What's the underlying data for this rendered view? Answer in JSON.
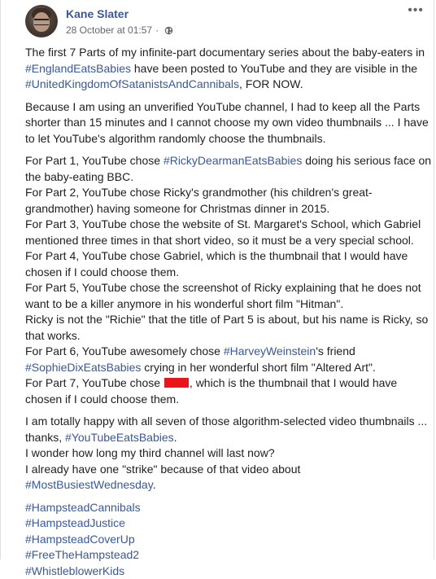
{
  "post": {
    "author": "Kane Slater",
    "timestamp": "28 October at 01:57",
    "separator": "·",
    "privacy_icon": "globe-icon",
    "more_label": "•••",
    "p1": {
      "a": "The first 7 Parts of my infinite-part documentary series about the baby-eaters in",
      "tag1": "#EnglandEatsBabies",
      "b": " have been posted to YouTube and they are visible in the",
      "tag2": "#UnitedKingdomOfSatanistsAndCannibals",
      "c": ", FOR NOW."
    },
    "p2": "Because I am using an unverified YouTube channel, I had to keep all the Parts shorter than 15 minutes and I cannot choose my own video thumbnails ... I have to let YouTube's algorithm randomly choose the thumbnails.",
    "p3": {
      "l1a": "For Part 1, YouTube chose ",
      "l1tag": "#RickyDearmanEatsBabies",
      "l1b": " doing his serious face on the baby-eating BBC.",
      "l2": "For Part 2, YouTube chose Ricky's grandmother (his children's great-grandmother) having someone for Christmas dinner in 2015.",
      "l3": "For Part 3, YouTube chose the website of St. Margaret's School, which Gabriel mentioned three times in that short video, so it must be a very special school.",
      "l4": "For Part 4, YouTube chose Gabriel, which is the thumbnail that I would have chosen if I could choose them.",
      "l5": "For Part 5, YouTube chose the screenshot of Ricky explaining that he does not want to be a killer anymore in his wonderful short film \"Hitman\".",
      "l6": "Ricky is not the \"Richie\" that the title of Part 5 is about, but his name is Ricky, so that works.",
      "l7a": "For Part 6, YouTube awesomely chose ",
      "l7tag1": "#HarveyWeinstein",
      "l7b": "'s friend",
      "l7tag2": "#SophieDixEatsBabies",
      "l7c": " crying in her wonderful short film \"Altered Art\".",
      "l8a": "For Part 7, YouTube chose ",
      "l8b": ", which is the thumbnail that I would have chosen if I could choose them."
    },
    "p4": {
      "l1a": "I am totally happy with all seven of those algorithm-selected video thumbnails ... thanks, ",
      "l1tag": "#YouTubeEatsBabies",
      "l1b": ".",
      "l2": "I wonder how long my third channel will last now?",
      "l3": "I already have one \"strike\" because of that video about",
      "l4tag": "#MostBusiestWednesday",
      "l4b": "."
    },
    "hashtags": [
      "#HampsteadCannibals",
      "#HampsteadJustice",
      "#HampsteadCoverUp",
      "#FreeTheHampstead2",
      "#WhistleblowerKids"
    ],
    "colors": {
      "link": "#385898",
      "text": "#1c1e21",
      "meta": "#606770",
      "redaction": "#e8161b"
    }
  }
}
